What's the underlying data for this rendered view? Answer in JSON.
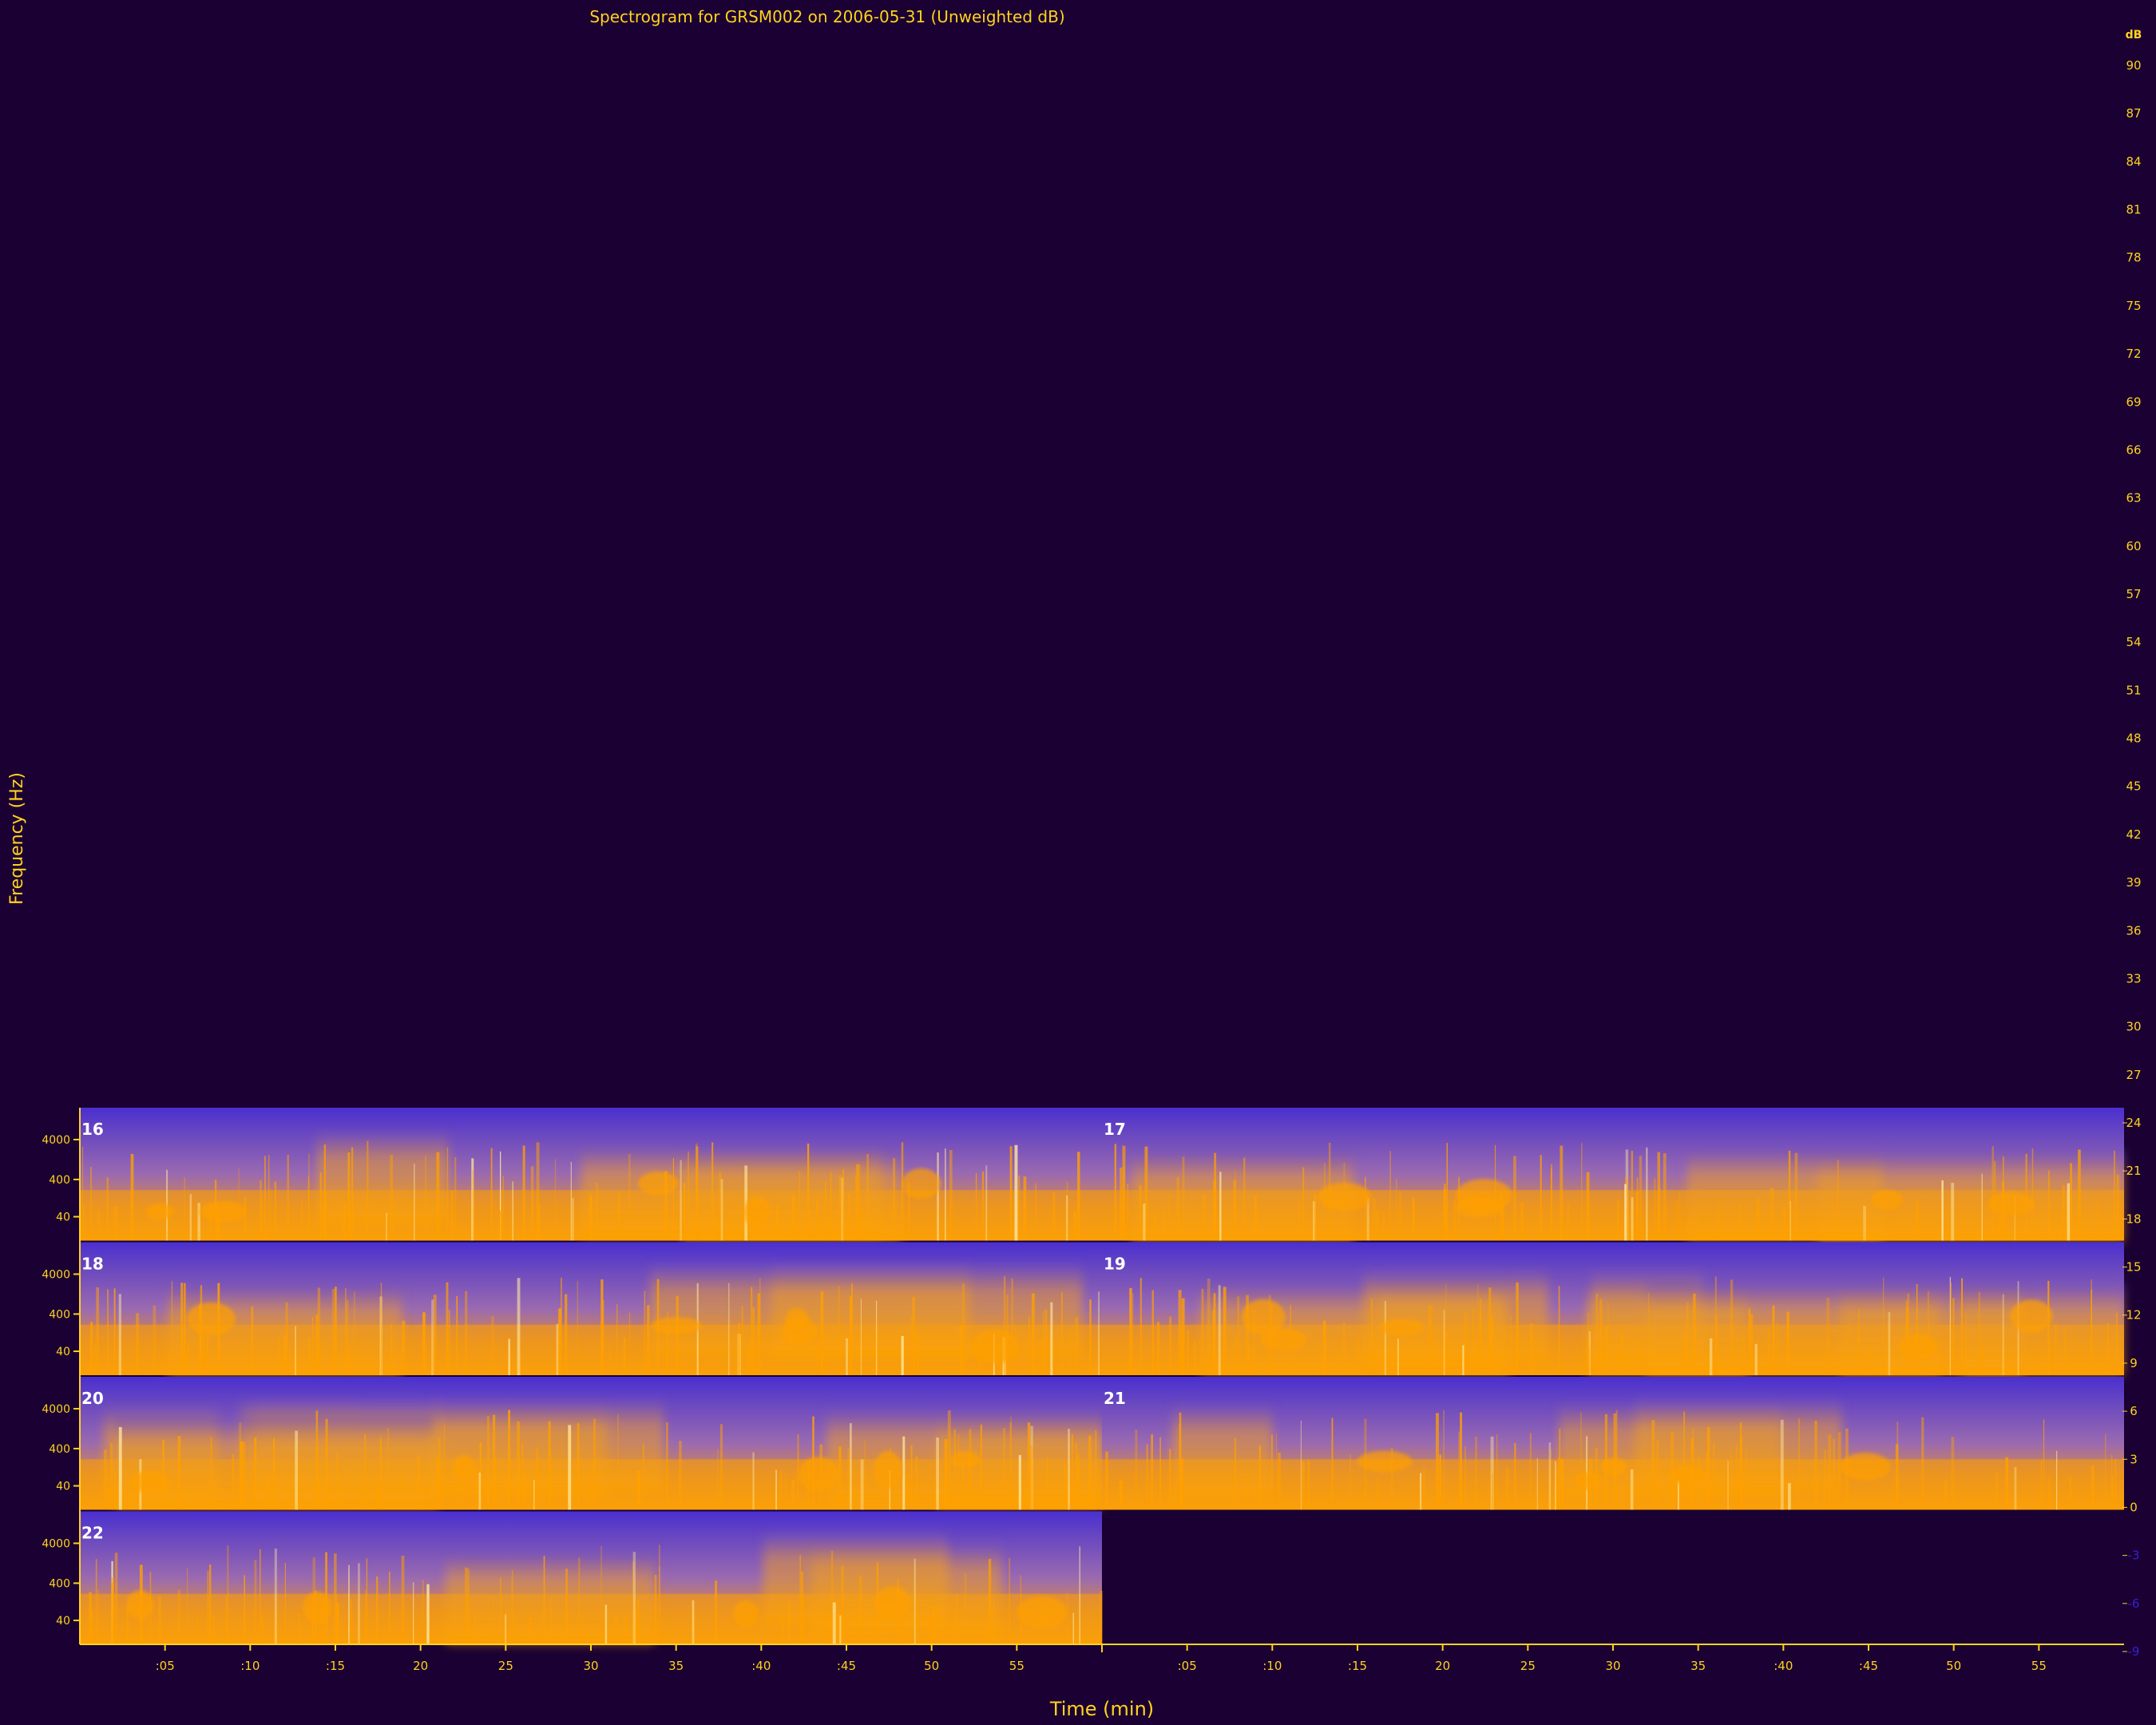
{
  "chart_data": {
    "type": "heatmap",
    "title": "Spectrogram for GRSM002 on 2006-05-31 (Unweighted dB)",
    "xlabel": "Time (min)",
    "ylabel": "Frequency (Hz)",
    "colorbar": {
      "unit": "dB",
      "ticks": [
        90,
        87,
        84,
        81,
        78,
        75,
        72,
        69,
        66,
        63,
        60,
        57,
        54,
        51,
        48,
        45,
        42,
        39,
        36,
        33,
        30,
        27,
        24,
        21,
        18,
        15,
        12,
        9,
        6,
        3,
        0,
        -3,
        -6,
        -9
      ],
      "range": [
        -9,
        90
      ]
    },
    "x_tick_labels": [
      ":05",
      ":10",
      ":15",
      "20",
      "25",
      "30",
      "35",
      ":40",
      ":45",
      "50",
      "55",
      ":05",
      ":10",
      ":15",
      "20",
      "25",
      "30",
      "35",
      ":40",
      ":45",
      "50",
      "55"
    ],
    "y_tick_labels": [
      "4000",
      "400",
      "40"
    ],
    "panels": [
      {
        "hour": "16",
        "row": 0,
        "col": 0,
        "minutes": 60
      },
      {
        "hour": "17",
        "row": 0,
        "col": 1,
        "minutes": 60
      },
      {
        "hour": "18",
        "row": 1,
        "col": 0,
        "minutes": 60
      },
      {
        "hour": "19",
        "row": 1,
        "col": 1,
        "minutes": 60
      },
      {
        "hour": "20",
        "row": 2,
        "col": 0,
        "minutes": 60
      },
      {
        "hour": "21",
        "row": 2,
        "col": 1,
        "minutes": 60
      },
      {
        "hour": "22",
        "row": 3,
        "col": 0,
        "minutes": 60
      }
    ],
    "colors": {
      "background": "#1a0033",
      "axis": "#ffd21e",
      "low": "#3a1fd6",
      "mid": "#9a6ab0",
      "high": "#ffa000",
      "peak": "#ffe9a0"
    }
  }
}
